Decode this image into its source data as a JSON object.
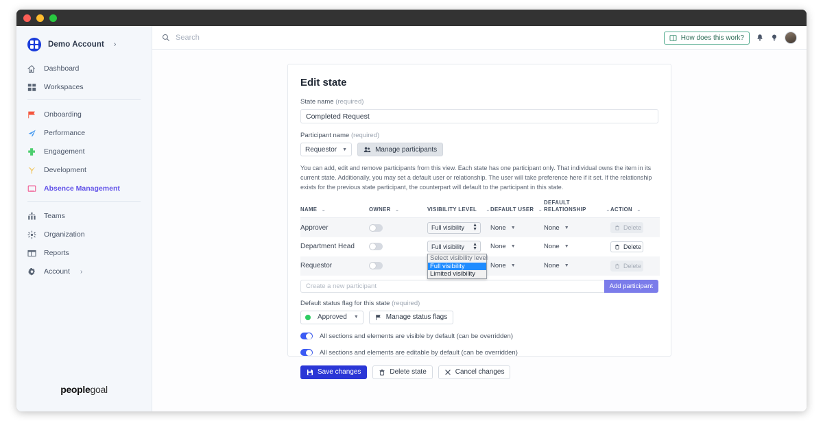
{
  "sidebar": {
    "account": {
      "name": "Demo Account",
      "caret": "›"
    },
    "groups": [
      {
        "items": [
          {
            "label": "Dashboard",
            "icon": "home-icon"
          },
          {
            "label": "Workspaces",
            "icon": "grid-icon"
          }
        ]
      },
      {
        "items": [
          {
            "label": "Onboarding",
            "icon": "flag-icon"
          },
          {
            "label": "Performance",
            "icon": "paper-plane-icon"
          },
          {
            "label": "Engagement",
            "icon": "puzzle-icon"
          },
          {
            "label": "Development",
            "icon": "sprout-icon"
          },
          {
            "label": "Absence Management",
            "icon": "monitor-icon",
            "active": true
          }
        ]
      },
      {
        "items": [
          {
            "label": "Teams",
            "icon": "teams-icon"
          },
          {
            "label": "Organization",
            "icon": "organization-icon"
          },
          {
            "label": "Reports",
            "icon": "reports-icon"
          },
          {
            "label": "Account",
            "icon": "gear-icon",
            "caret": "›"
          }
        ]
      }
    ],
    "footer_logo_bold": "people",
    "footer_logo_light": "goal"
  },
  "topbar": {
    "search_placeholder": "Search",
    "search_value": "",
    "help_button": "How does this work?"
  },
  "card": {
    "title": "Edit state",
    "state_name_label": "State name",
    "required_tag": "(required)",
    "state_name_value": "Completed Request",
    "participant_name_label": "Participant name",
    "participant_select_value": "Requestor",
    "manage_participants_button": "Manage participants",
    "description": "You can add, edit and remove participants from this view. Each state has one participant only. That individual owns the item in its current state. Additionally, you may set a default user or relationship. The user will take preference here if it set. If the relationship exists for the previous state participant, the counterpart will default to the participant in this state.",
    "table": {
      "columns": [
        "NAME",
        "OWNER",
        "VISIBILITY LEVEL",
        "DEFAULT USER",
        "DEFAULT RELATIONSHIP",
        "ACTION"
      ],
      "rows": [
        {
          "name": "Approver",
          "owner_on": false,
          "visibility": "Full visibility",
          "default_user": "None",
          "default_relationship": "None",
          "action_label": "Delete",
          "action_disabled": true
        },
        {
          "name": "Department Head",
          "owner_on": false,
          "visibility": "Full visibility",
          "default_user": "None",
          "default_relationship": "None",
          "action_label": "Delete",
          "action_disabled": false
        },
        {
          "name": "Requestor",
          "owner_on": false,
          "visibility": "Full visibility",
          "default_user": "None",
          "default_relationship": "None",
          "action_label": "Delete",
          "action_disabled": true
        }
      ]
    },
    "add_participant_placeholder": "Create a new participant",
    "add_participant_value": "",
    "add_participant_button": "Add participant",
    "visibility_dropdown": {
      "options": [
        "Select visibility level",
        "Full visibility",
        "Limited visibility"
      ],
      "selected": "Full visibility"
    },
    "status_flag_label": "Default status flag for this state",
    "status_flag_value": "Approved",
    "manage_status_flags_button": "Manage status flags",
    "toggle_visible_label": "All sections and elements are visible by default (can be overridden)",
    "toggle_editable_label": "All sections and elements are editable by default (can be overridden)",
    "save_button": "Save changes",
    "delete_button": "Delete state",
    "cancel_button": "Cancel changes"
  },
  "colors": {
    "accent_blue": "#2a36d6",
    "toggle_on": "#3b5bf5",
    "add_participant": "#7b7cea",
    "dropdown_highlight": "#1f8cff",
    "active_nav": "#6253e8",
    "status_green": "#2ecc62",
    "help_border": "#4fa98c"
  }
}
